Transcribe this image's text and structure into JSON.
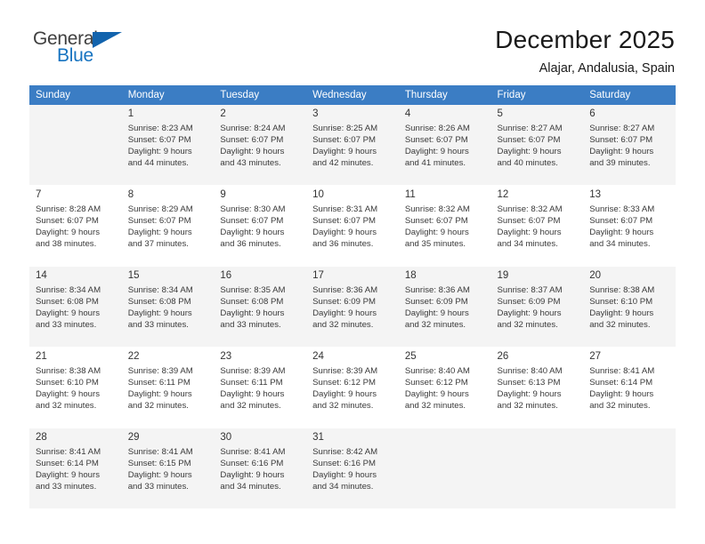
{
  "brand": {
    "word_one": "General",
    "word_two": "Blue",
    "flag_icon": "triangle-flag-icon",
    "accent_color": "#1673c0"
  },
  "header": {
    "month_title": "December 2025",
    "location": "Alajar, Andalusia, Spain"
  },
  "calendar": {
    "header_bg": "#3b7dc4",
    "weekday_headers": [
      "Sunday",
      "Monday",
      "Tuesday",
      "Wednesday",
      "Thursday",
      "Friday",
      "Saturday"
    ],
    "weeks": [
      [
        {
          "day": "",
          "sunrise": "",
          "sunset": "",
          "daylight_line1": "",
          "daylight_line2": ""
        },
        {
          "day": "1",
          "sunrise": "Sunrise: 8:23 AM",
          "sunset": "Sunset: 6:07 PM",
          "daylight_line1": "Daylight: 9 hours",
          "daylight_line2": "and 44 minutes."
        },
        {
          "day": "2",
          "sunrise": "Sunrise: 8:24 AM",
          "sunset": "Sunset: 6:07 PM",
          "daylight_line1": "Daylight: 9 hours",
          "daylight_line2": "and 43 minutes."
        },
        {
          "day": "3",
          "sunrise": "Sunrise: 8:25 AM",
          "sunset": "Sunset: 6:07 PM",
          "daylight_line1": "Daylight: 9 hours",
          "daylight_line2": "and 42 minutes."
        },
        {
          "day": "4",
          "sunrise": "Sunrise: 8:26 AM",
          "sunset": "Sunset: 6:07 PM",
          "daylight_line1": "Daylight: 9 hours",
          "daylight_line2": "and 41 minutes."
        },
        {
          "day": "5",
          "sunrise": "Sunrise: 8:27 AM",
          "sunset": "Sunset: 6:07 PM",
          "daylight_line1": "Daylight: 9 hours",
          "daylight_line2": "and 40 minutes."
        },
        {
          "day": "6",
          "sunrise": "Sunrise: 8:27 AM",
          "sunset": "Sunset: 6:07 PM",
          "daylight_line1": "Daylight: 9 hours",
          "daylight_line2": "and 39 minutes."
        }
      ],
      [
        {
          "day": "7",
          "sunrise": "Sunrise: 8:28 AM",
          "sunset": "Sunset: 6:07 PM",
          "daylight_line1": "Daylight: 9 hours",
          "daylight_line2": "and 38 minutes."
        },
        {
          "day": "8",
          "sunrise": "Sunrise: 8:29 AM",
          "sunset": "Sunset: 6:07 PM",
          "daylight_line1": "Daylight: 9 hours",
          "daylight_line2": "and 37 minutes."
        },
        {
          "day": "9",
          "sunrise": "Sunrise: 8:30 AM",
          "sunset": "Sunset: 6:07 PM",
          "daylight_line1": "Daylight: 9 hours",
          "daylight_line2": "and 36 minutes."
        },
        {
          "day": "10",
          "sunrise": "Sunrise: 8:31 AM",
          "sunset": "Sunset: 6:07 PM",
          "daylight_line1": "Daylight: 9 hours",
          "daylight_line2": "and 36 minutes."
        },
        {
          "day": "11",
          "sunrise": "Sunrise: 8:32 AM",
          "sunset": "Sunset: 6:07 PM",
          "daylight_line1": "Daylight: 9 hours",
          "daylight_line2": "and 35 minutes."
        },
        {
          "day": "12",
          "sunrise": "Sunrise: 8:32 AM",
          "sunset": "Sunset: 6:07 PM",
          "daylight_line1": "Daylight: 9 hours",
          "daylight_line2": "and 34 minutes."
        },
        {
          "day": "13",
          "sunrise": "Sunrise: 8:33 AM",
          "sunset": "Sunset: 6:07 PM",
          "daylight_line1": "Daylight: 9 hours",
          "daylight_line2": "and 34 minutes."
        }
      ],
      [
        {
          "day": "14",
          "sunrise": "Sunrise: 8:34 AM",
          "sunset": "Sunset: 6:08 PM",
          "daylight_line1": "Daylight: 9 hours",
          "daylight_line2": "and 33 minutes."
        },
        {
          "day": "15",
          "sunrise": "Sunrise: 8:34 AM",
          "sunset": "Sunset: 6:08 PM",
          "daylight_line1": "Daylight: 9 hours",
          "daylight_line2": "and 33 minutes."
        },
        {
          "day": "16",
          "sunrise": "Sunrise: 8:35 AM",
          "sunset": "Sunset: 6:08 PM",
          "daylight_line1": "Daylight: 9 hours",
          "daylight_line2": "and 33 minutes."
        },
        {
          "day": "17",
          "sunrise": "Sunrise: 8:36 AM",
          "sunset": "Sunset: 6:09 PM",
          "daylight_line1": "Daylight: 9 hours",
          "daylight_line2": "and 32 minutes."
        },
        {
          "day": "18",
          "sunrise": "Sunrise: 8:36 AM",
          "sunset": "Sunset: 6:09 PM",
          "daylight_line1": "Daylight: 9 hours",
          "daylight_line2": "and 32 minutes."
        },
        {
          "day": "19",
          "sunrise": "Sunrise: 8:37 AM",
          "sunset": "Sunset: 6:09 PM",
          "daylight_line1": "Daylight: 9 hours",
          "daylight_line2": "and 32 minutes."
        },
        {
          "day": "20",
          "sunrise": "Sunrise: 8:38 AM",
          "sunset": "Sunset: 6:10 PM",
          "daylight_line1": "Daylight: 9 hours",
          "daylight_line2": "and 32 minutes."
        }
      ],
      [
        {
          "day": "21",
          "sunrise": "Sunrise: 8:38 AM",
          "sunset": "Sunset: 6:10 PM",
          "daylight_line1": "Daylight: 9 hours",
          "daylight_line2": "and 32 minutes."
        },
        {
          "day": "22",
          "sunrise": "Sunrise: 8:39 AM",
          "sunset": "Sunset: 6:11 PM",
          "daylight_line1": "Daylight: 9 hours",
          "daylight_line2": "and 32 minutes."
        },
        {
          "day": "23",
          "sunrise": "Sunrise: 8:39 AM",
          "sunset": "Sunset: 6:11 PM",
          "daylight_line1": "Daylight: 9 hours",
          "daylight_line2": "and 32 minutes."
        },
        {
          "day": "24",
          "sunrise": "Sunrise: 8:39 AM",
          "sunset": "Sunset: 6:12 PM",
          "daylight_line1": "Daylight: 9 hours",
          "daylight_line2": "and 32 minutes."
        },
        {
          "day": "25",
          "sunrise": "Sunrise: 8:40 AM",
          "sunset": "Sunset: 6:12 PM",
          "daylight_line1": "Daylight: 9 hours",
          "daylight_line2": "and 32 minutes."
        },
        {
          "day": "26",
          "sunrise": "Sunrise: 8:40 AM",
          "sunset": "Sunset: 6:13 PM",
          "daylight_line1": "Daylight: 9 hours",
          "daylight_line2": "and 32 minutes."
        },
        {
          "day": "27",
          "sunrise": "Sunrise: 8:41 AM",
          "sunset": "Sunset: 6:14 PM",
          "daylight_line1": "Daylight: 9 hours",
          "daylight_line2": "and 32 minutes."
        }
      ],
      [
        {
          "day": "28",
          "sunrise": "Sunrise: 8:41 AM",
          "sunset": "Sunset: 6:14 PM",
          "daylight_line1": "Daylight: 9 hours",
          "daylight_line2": "and 33 minutes."
        },
        {
          "day": "29",
          "sunrise": "Sunrise: 8:41 AM",
          "sunset": "Sunset: 6:15 PM",
          "daylight_line1": "Daylight: 9 hours",
          "daylight_line2": "and 33 minutes."
        },
        {
          "day": "30",
          "sunrise": "Sunrise: 8:41 AM",
          "sunset": "Sunset: 6:16 PM",
          "daylight_line1": "Daylight: 9 hours",
          "daylight_line2": "and 34 minutes."
        },
        {
          "day": "31",
          "sunrise": "Sunrise: 8:42 AM",
          "sunset": "Sunset: 6:16 PM",
          "daylight_line1": "Daylight: 9 hours",
          "daylight_line2": "and 34 minutes."
        },
        {
          "day": "",
          "sunrise": "",
          "sunset": "",
          "daylight_line1": "",
          "daylight_line2": ""
        },
        {
          "day": "",
          "sunrise": "",
          "sunset": "",
          "daylight_line1": "",
          "daylight_line2": ""
        },
        {
          "day": "",
          "sunrise": "",
          "sunset": "",
          "daylight_line1": "",
          "daylight_line2": ""
        }
      ]
    ]
  }
}
